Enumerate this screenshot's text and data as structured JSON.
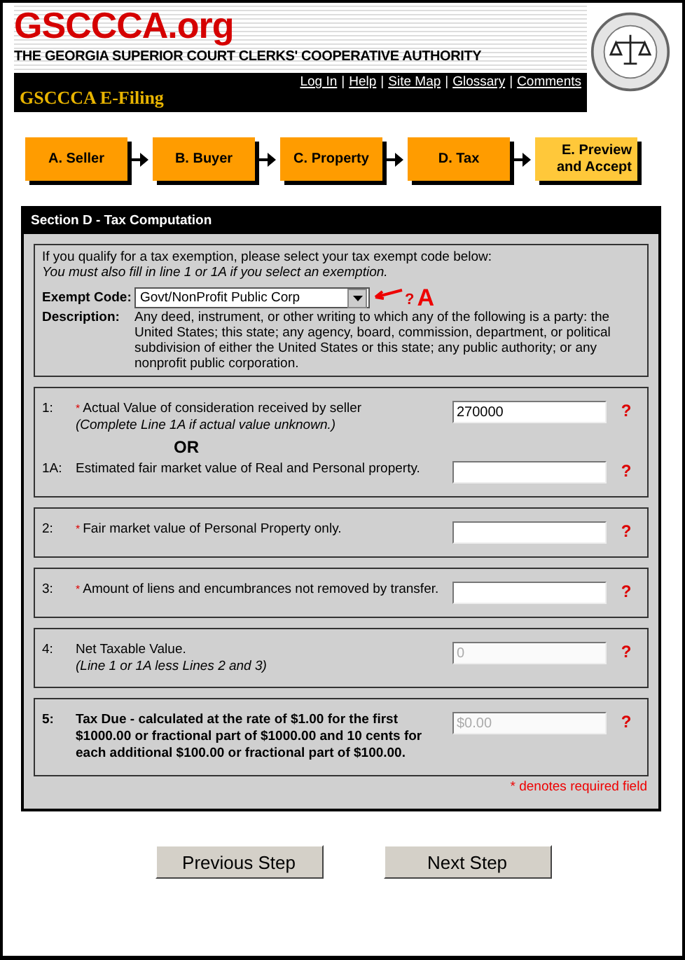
{
  "header": {
    "logo": "GSCCCA.org",
    "tagline": "THE GEORGIA SUPERIOR COURT CLERKS' COOPERATIVE AUTHORITY",
    "app_title": "GSCCCA E-Filing",
    "links": [
      "Log In",
      "Help",
      "Site Map",
      "Glossary",
      "Comments"
    ],
    "separator": "|"
  },
  "steps": [
    {
      "label": "A. Seller",
      "selected": false
    },
    {
      "label": "B. Buyer",
      "selected": false
    },
    {
      "label": "C. Property",
      "selected": false
    },
    {
      "label": "D. Tax",
      "selected": false
    },
    {
      "label": "E. Preview and Accept",
      "selected": true
    }
  ],
  "section": {
    "title": "Section D - Tax Computation",
    "exemption": {
      "intro": "If you qualify for a tax exemption, please select your tax exempt code below:",
      "note": "You must also fill in line 1 or 1A if you select an exemption.",
      "code_label": "Exempt Code:",
      "code_value": "Govt/NonProfit Public Corp",
      "help": "?",
      "annotation": "A",
      "description_label": "Description:",
      "description": "Any deed, instrument, or other writing to which any of the following is a party: the United States; this state; any agency, board, commission, department, or political subdivision of either the United States or this state; any public authority; or any nonprofit public corporation."
    },
    "groups": [
      {
        "lines": [
          {
            "number": "1:",
            "required": true,
            "label": "Actual Value of consideration received by seller",
            "note": "(Complete Line 1A if actual value unknown.)",
            "value": "270000",
            "bold": false,
            "help": "?"
          },
          {
            "separator": "OR",
            "number": "1A:",
            "required": false,
            "label": "Estimated fair market value of Real and Personal property.",
            "bold": false,
            "help": "?"
          }
        ]
      },
      {
        "lines": [
          {
            "number": "2:",
            "required": true,
            "label": "Fair market value of Personal Property only.",
            "bold": false,
            "help": "?"
          }
        ]
      },
      {
        "lines": [
          {
            "number": "3:",
            "required": true,
            "label": "Amount of liens and encumbrances not removed by transfer.",
            "bold": false,
            "help": "?"
          }
        ]
      },
      {
        "lines": [
          {
            "number": "4:",
            "required": false,
            "label": "Net Taxable Value.",
            "note": "(Line 1 or 1A less Lines 2 and 3)",
            "value": "0",
            "disabled": true,
            "bold": false,
            "help": "?"
          }
        ]
      },
      {
        "lines": [
          {
            "number": "5:",
            "required": false,
            "label": "Tax Due - calculated at the rate of $1.00 for the first $1000.00 or fractional part of $1000.00 and 10 cents for each additional $100.00 or fractional part of $100.00.",
            "value": "$0.00",
            "disabled": true,
            "bold": true,
            "help": "?"
          }
        ]
      }
    ],
    "required_mark": "*",
    "required_note": "* denotes required field"
  },
  "buttons": [
    "Previous Step",
    "Next Step"
  ]
}
